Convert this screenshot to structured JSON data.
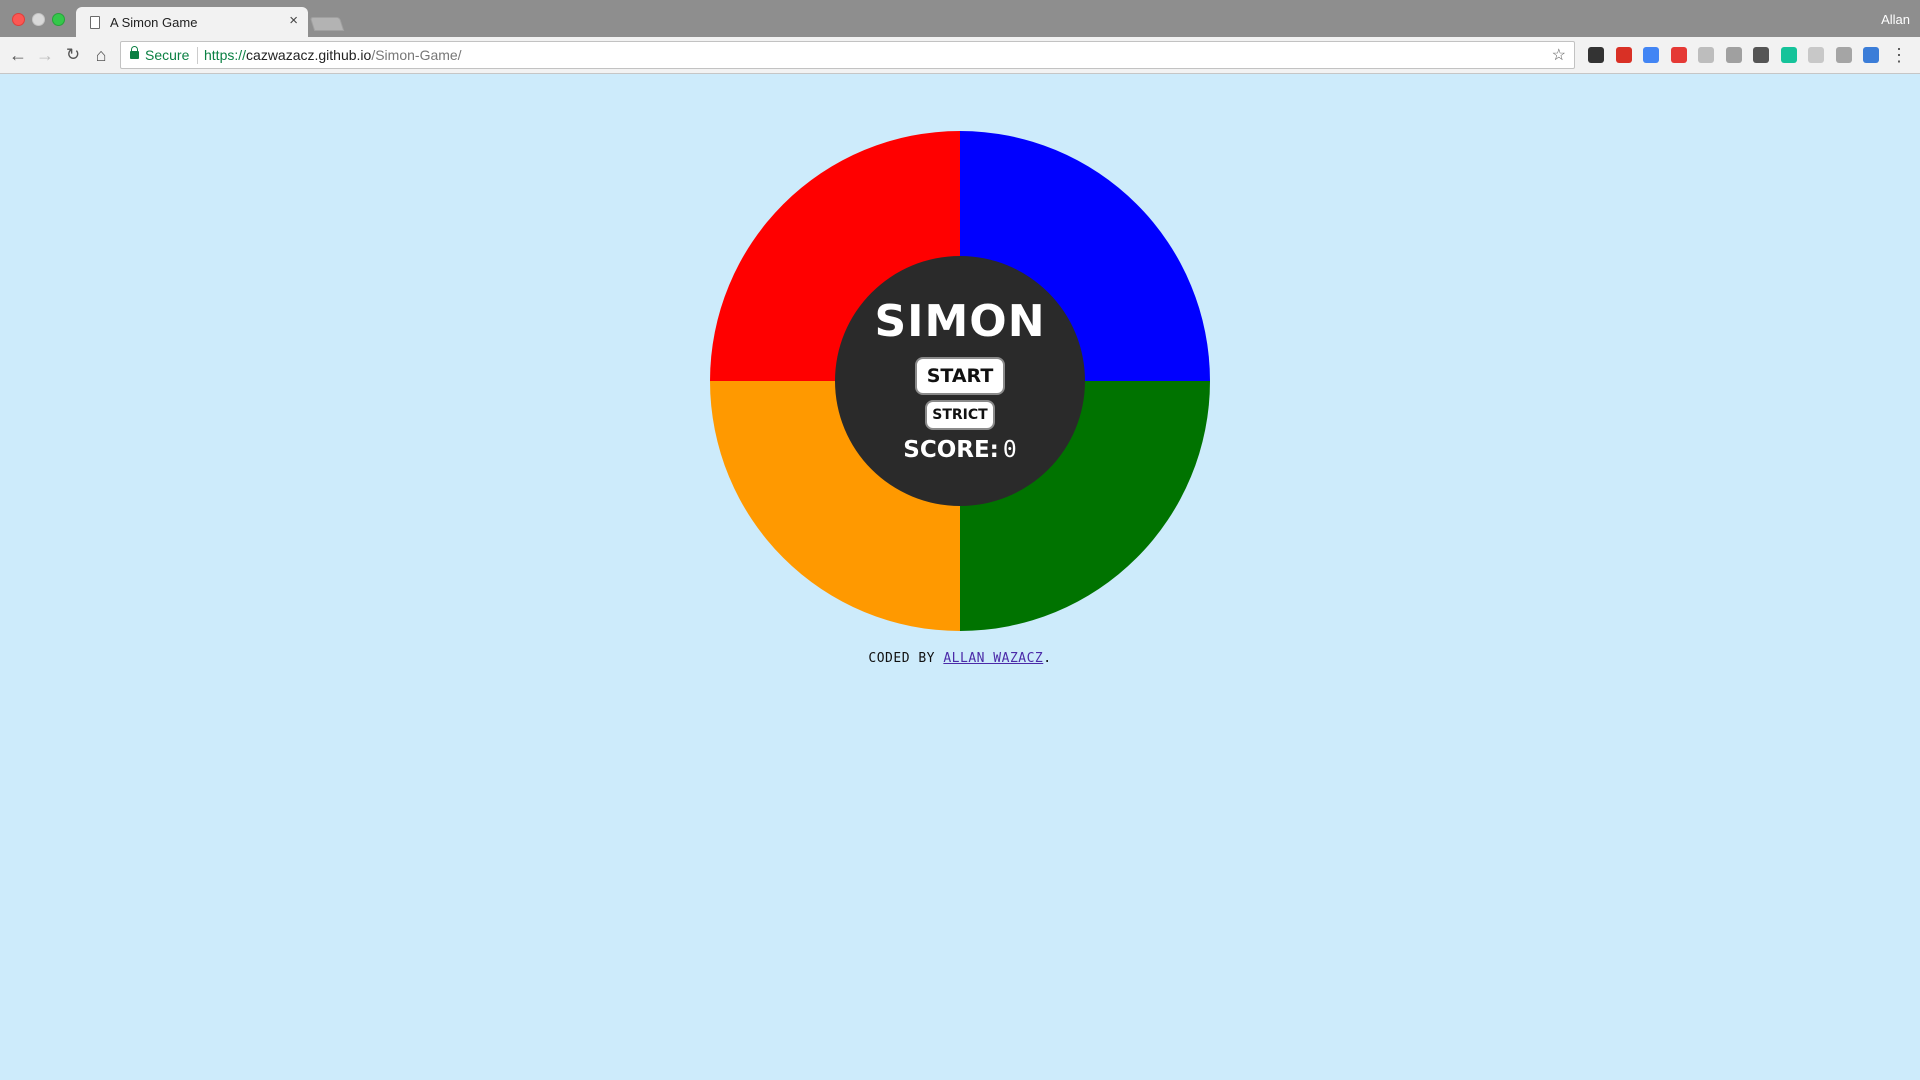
{
  "browser": {
    "tab_title": "A Simon Game",
    "tab_close": "×",
    "profile_name": "Allan",
    "secure_label": "Secure",
    "url_scheme": "https://",
    "url_host": "cazwazacz.github.io",
    "url_path": "/Simon-Game/",
    "extensions": [
      {
        "name": "extension-icon-1",
        "color": "#333333"
      },
      {
        "name": "gmail-icon",
        "color": "#d93025"
      },
      {
        "name": "calendar-icon",
        "color": "#4285f4"
      },
      {
        "name": "adblock-icon",
        "color": "#e53935"
      },
      {
        "name": "extension-icon-5",
        "color": "#bdbdbd"
      },
      {
        "name": "reddit-icon",
        "color": "#a0a0a0"
      },
      {
        "name": "extension-icon-7",
        "color": "#555555"
      },
      {
        "name": "grammarly-icon",
        "color": "#15c39a"
      },
      {
        "name": "extension-icon-9",
        "color": "#c8c8c8"
      },
      {
        "name": "extension-icon-10",
        "color": "#a5a5a5"
      },
      {
        "name": "screenshot-icon",
        "color": "#3b7dd8"
      }
    ]
  },
  "game": {
    "title": "SIMON",
    "start_label": "START",
    "strict_label": "STRICT",
    "score_label": "SCORE:",
    "score_value": "0",
    "colors": {
      "red": "#ff0000",
      "blue": "#0000ff",
      "orange": "#ff9900",
      "green": "#007300",
      "center": "#2a2a2a",
      "background": "#cdebfb"
    }
  },
  "footer": {
    "prefix": "CODED BY",
    "author": "ALLAN WAZACZ",
    "suffix": "."
  }
}
